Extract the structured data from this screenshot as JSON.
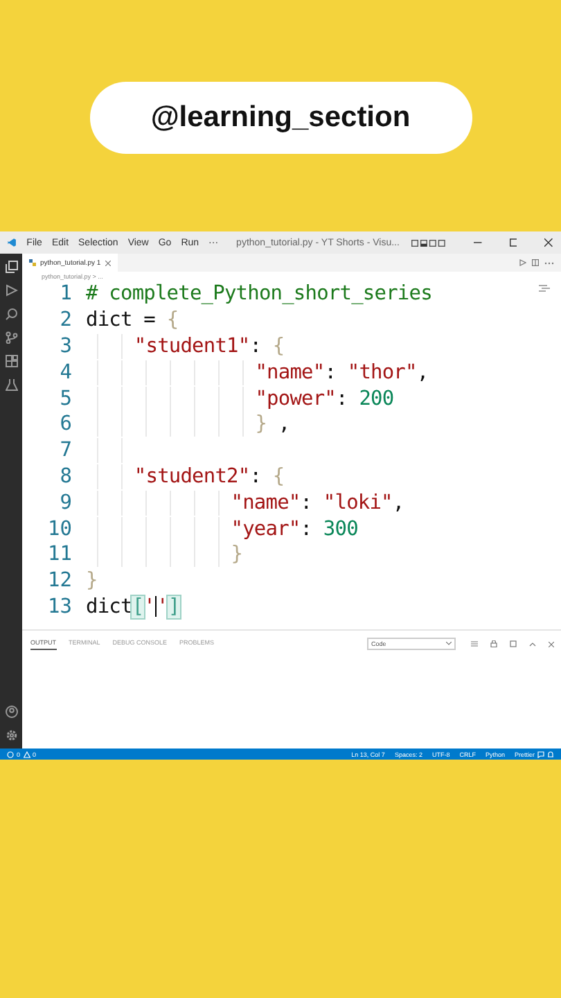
{
  "channel_badge": {
    "text": "@learning_section"
  },
  "title_bar": {
    "menu": [
      "File",
      "Edit",
      "Selection",
      "View",
      "Go",
      "Run",
      "···"
    ],
    "title": "python_tutorial.py - YT Shorts - Visu..."
  },
  "tabs": [
    {
      "label": "python_tutorial.py",
      "badge": "1",
      "selected": true
    }
  ],
  "breadcrumb": "python_tutorial.py > ...",
  "code": [
    {
      "number": "1",
      "kind": "top",
      "tokens": [
        {
          "kind": "comment",
          "text": "# complete_Python_short_series"
        }
      ]
    },
    {
      "number": "2",
      "kind": "top",
      "tokens": [
        {
          "kind": "plain",
          "text": "dict = "
        },
        {
          "kind": "brace",
          "text": "{"
        }
      ]
    },
    {
      "number": "3",
      "kind": "nested",
      "tokens": [
        {
          "kind": "string",
          "text": "\"student1\""
        },
        {
          "kind": "plain",
          "text": ": "
        },
        {
          "kind": "brace",
          "text": "{"
        }
      ]
    },
    {
      "number": "4",
      "kind": "deep",
      "tokens": [
        {
          "kind": "string",
          "text": "\"name\""
        },
        {
          "kind": "plain",
          "text": ": "
        },
        {
          "kind": "string",
          "text": "\"thor\""
        },
        {
          "kind": "plain",
          "text": ","
        }
      ]
    },
    {
      "number": "5",
      "kind": "deep",
      "tokens": [
        {
          "kind": "string",
          "text": "\"power\""
        },
        {
          "kind": "plain",
          "text": ": "
        },
        {
          "kind": "number",
          "text": "200"
        }
      ]
    },
    {
      "number": "6",
      "kind": "deep",
      "tokens": [
        {
          "kind": "brace",
          "text": "}"
        },
        {
          "kind": "plain",
          "text": " ,"
        }
      ]
    },
    {
      "number": "7",
      "kind": "nested"
    },
    {
      "number": "8",
      "kind": "nested",
      "tokens": [
        {
          "kind": "string",
          "text": "\"student2\""
        },
        {
          "kind": "plain",
          "text": ": "
        },
        {
          "kind": "brace",
          "text": "{"
        }
      ]
    },
    {
      "number": "9",
      "kind": "inner",
      "tokens": [
        {
          "kind": "string",
          "text": "\"name\""
        },
        {
          "kind": "plain",
          "text": ": "
        },
        {
          "kind": "string",
          "text": "\"loki\""
        },
        {
          "kind": "plain",
          "text": ","
        }
      ]
    },
    {
      "number": "10",
      "kind": "inner",
      "tokens": [
        {
          "kind": "string",
          "text": "\"year\""
        },
        {
          "kind": "plain",
          "text": ": "
        },
        {
          "kind": "number",
          "text": "300"
        }
      ]
    },
    {
      "number": "11",
      "kind": "inner",
      "tokens": [
        {
          "kind": "brace",
          "text": "}"
        }
      ]
    },
    {
      "number": "12",
      "kind": "top",
      "tokens": [
        {
          "kind": "brace",
          "text": "}"
        }
      ]
    },
    {
      "number": "13",
      "kind": "top",
      "tokens": [
        {
          "kind": "plain",
          "text": "dict"
        },
        {
          "kind": "match",
          "text": "["
        },
        {
          "kind": "string",
          "text": "'"
        },
        {
          "kind": "cursor"
        },
        {
          "kind": "string",
          "text": "'"
        },
        {
          "kind": "match",
          "text": "]"
        }
      ]
    }
  ],
  "panel": {
    "tabs": [
      {
        "label": "OUTPUT",
        "selected": true
      },
      {
        "label": "TERMINAL",
        "selected": false
      },
      {
        "label": "DEBUG CONSOLE",
        "selected": false
      },
      {
        "label": "PROBLEMS",
        "selected": false
      }
    ],
    "dropdown": "Code"
  },
  "status_bar": {
    "errors": "0",
    "warnings": "0",
    "items": [
      "Ln 13, Col 7",
      "Spaces: 2",
      "UTF-8",
      "CRLF",
      "Python",
      "Prettier"
    ]
  }
}
